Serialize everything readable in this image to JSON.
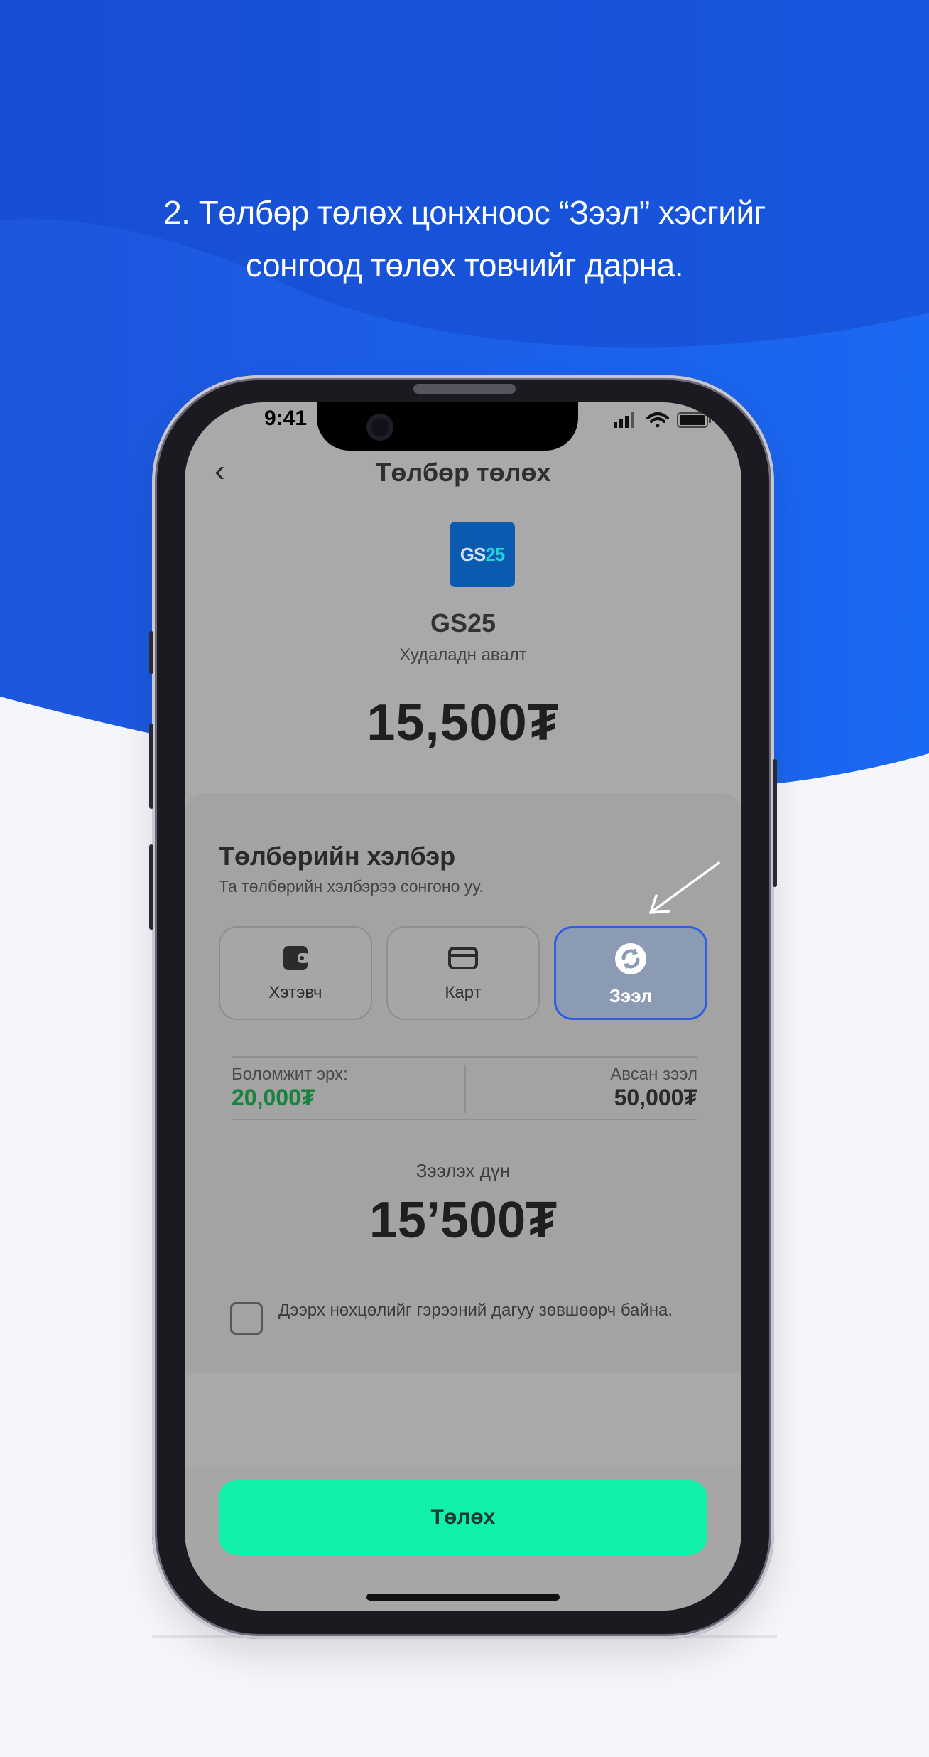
{
  "caption": {
    "line1": "2. Төлбөр төлөх цонхноос “Зээл” хэсгийг",
    "line2": "сонгоод төлөх товчийг дарна."
  },
  "status_bar": {
    "time": "9:41"
  },
  "nav": {
    "back": "‹",
    "title": "Төлбөр төлөх"
  },
  "merchant": {
    "logo_letters": "GS",
    "logo_number": "25",
    "name": "GS25",
    "subtitle": "Худаладн авалт",
    "amount": "15,500₮"
  },
  "payment_method": {
    "title": "Төлбөрийн хэлбэр",
    "subtitle": "Та төлбөрийн хэлбэрээ сонгоно уу.",
    "options": [
      {
        "label": "Хэтэвч",
        "icon": "wallet-icon",
        "selected": false
      },
      {
        "label": "Карт",
        "icon": "card-icon",
        "selected": false
      },
      {
        "label": "Зээл",
        "icon": "loan-refresh-icon",
        "selected": true
      }
    ]
  },
  "limits": {
    "available_label": "Боломжит эрх:",
    "available_value": "20,000₮",
    "taken_label": "Авсан зээл",
    "taken_value": "50,000₮"
  },
  "loan": {
    "label": "Зээлэх дүн",
    "amount": "15’500₮"
  },
  "agreement": {
    "checked": false,
    "text": "Дээрх нөхцөлийг гэрээний дагуу зөвшөөрч байна."
  },
  "pay_button": {
    "label": "Төлөх"
  },
  "colors": {
    "brand_blue": "#1a5ee3",
    "accent_green": "#10f0ab",
    "available_green": "#17833e",
    "selected_border": "#2f5fe0"
  }
}
